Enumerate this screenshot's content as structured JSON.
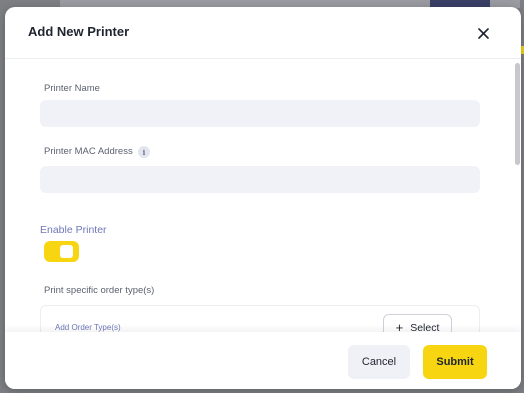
{
  "modal": {
    "title": "Add New Printer"
  },
  "form": {
    "printer_name": {
      "label": "Printer Name",
      "value": "",
      "placeholder": ""
    },
    "printer_mac": {
      "label": "Printer MAC Address",
      "info_icon_glyph": "i",
      "value": "",
      "placeholder": ""
    },
    "enable_printer": {
      "label": "Enable Printer",
      "enabled": true
    },
    "order_types": {
      "label": "Print specific order type(s)",
      "placeholder": "Add Order Type(s)",
      "select_label": "Select"
    }
  },
  "footer": {
    "cancel_label": "Cancel",
    "submit_label": "Submit"
  },
  "colors": {
    "accent": "#f7d611",
    "label_accent": "#6f78b8"
  }
}
